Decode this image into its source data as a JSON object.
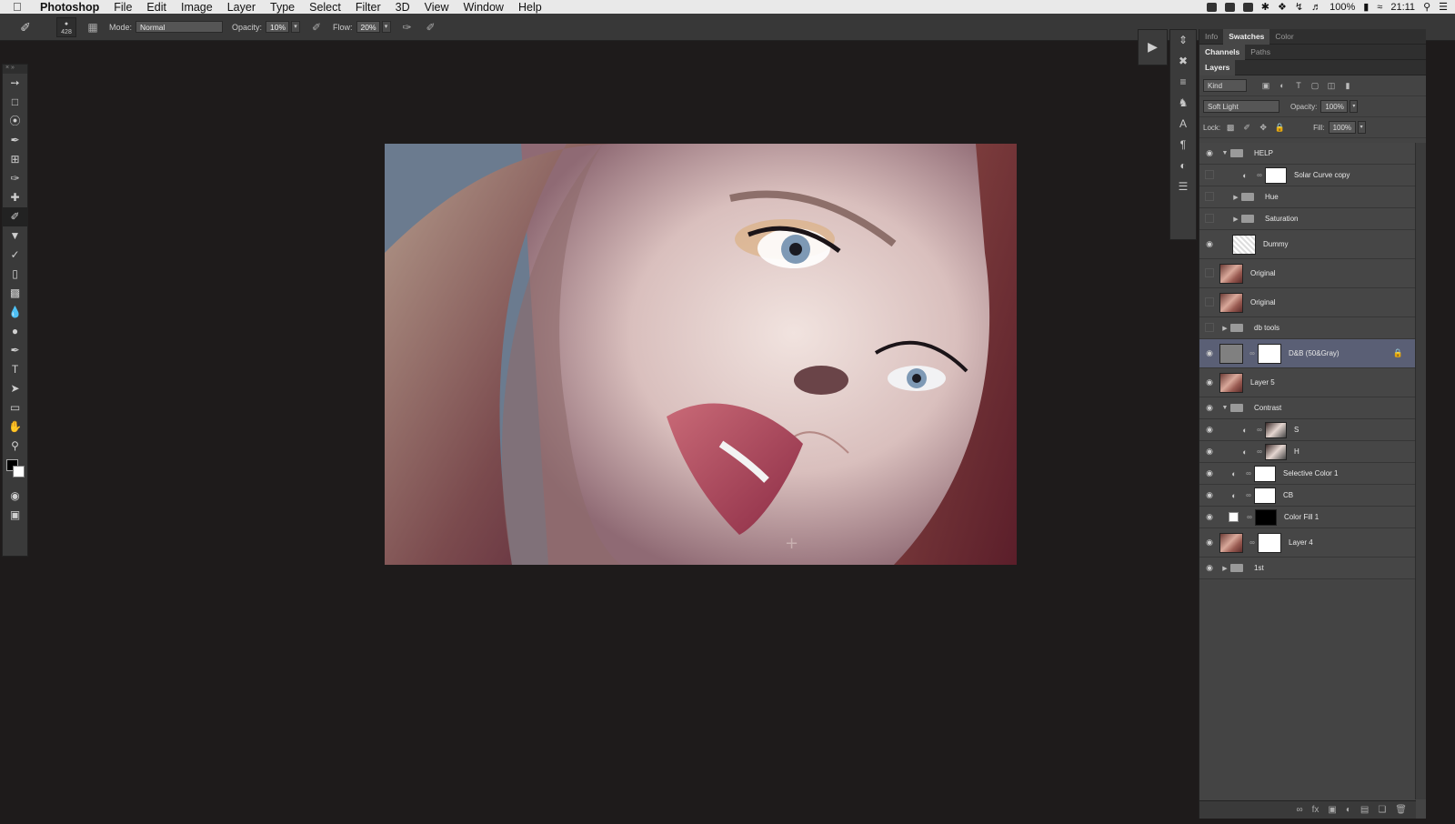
{
  "menubar": {
    "app_name": "Photoshop",
    "menus": [
      "File",
      "Edit",
      "Image",
      "Layer",
      "Type",
      "Select",
      "Filter",
      "3D",
      "View",
      "Window",
      "Help"
    ],
    "battery": "100%",
    "clock": "21:11"
  },
  "options": {
    "brush_size": "428",
    "mode_label": "Mode:",
    "mode_value": "Normal",
    "opacity_label": "Opacity:",
    "opacity_value": "10%",
    "flow_label": "Flow:",
    "flow_value": "20%"
  },
  "panels": {
    "tabs_top": [
      "Info",
      "Swatches",
      "Color"
    ],
    "tabs_mid": [
      "Channels",
      "Paths"
    ],
    "layers_title": "Layers",
    "filter_kind": "Kind",
    "blend_mode": "Soft Light",
    "opacity_label": "Opacity:",
    "opacity_value": "100%",
    "lock_label": "Lock:",
    "fill_label": "Fill:",
    "fill_value": "100%"
  },
  "layers": [
    {
      "name": "HELP",
      "kind": "group-open",
      "visible": true
    },
    {
      "name": "Solar Curve copy",
      "kind": "adjustment",
      "visible": false,
      "mask": "white"
    },
    {
      "name": "Hue",
      "kind": "group-closed-nested",
      "visible": false
    },
    {
      "name": "Saturation",
      "kind": "group-closed-nested",
      "visible": false
    },
    {
      "name": "Dummy",
      "kind": "pixel",
      "visible": true,
      "thumb": "checker"
    },
    {
      "name": "Original",
      "kind": "pixel-tall",
      "visible": false,
      "thumb": "face"
    },
    {
      "name": "Original",
      "kind": "pixel-tall",
      "visible": false,
      "thumb": "face"
    },
    {
      "name": "db tools",
      "kind": "group-closed",
      "visible": false
    },
    {
      "name": "D&B (50&Gray)",
      "kind": "masked-selected",
      "visible": true,
      "thumb": "gray",
      "mask": "white"
    },
    {
      "name": "Layer 5",
      "kind": "pixel-tall",
      "visible": true,
      "thumb": "face"
    },
    {
      "name": "Contrast",
      "kind": "group-open",
      "visible": true
    },
    {
      "name": "S",
      "kind": "adjustment-nested",
      "visible": true,
      "mask": "face2"
    },
    {
      "name": "H",
      "kind": "adjustment-nested",
      "visible": true,
      "mask": "face2"
    },
    {
      "name": "Selective Color 1",
      "kind": "adjustment",
      "visible": true,
      "mask": "white"
    },
    {
      "name": "CB",
      "kind": "adjustment",
      "visible": true,
      "mask": "white"
    },
    {
      "name": "Color Fill 1",
      "kind": "fill",
      "visible": true,
      "mask": "black"
    },
    {
      "name": "Layer 4",
      "kind": "masked",
      "visible": true,
      "thumb": "face",
      "mask": "white"
    },
    {
      "name": "1st",
      "kind": "group-closed",
      "visible": true
    }
  ],
  "colors": {
    "app_bg": "#1e1b1b",
    "panel_bg": "#444444",
    "selected_layer": "#5a5f75"
  }
}
